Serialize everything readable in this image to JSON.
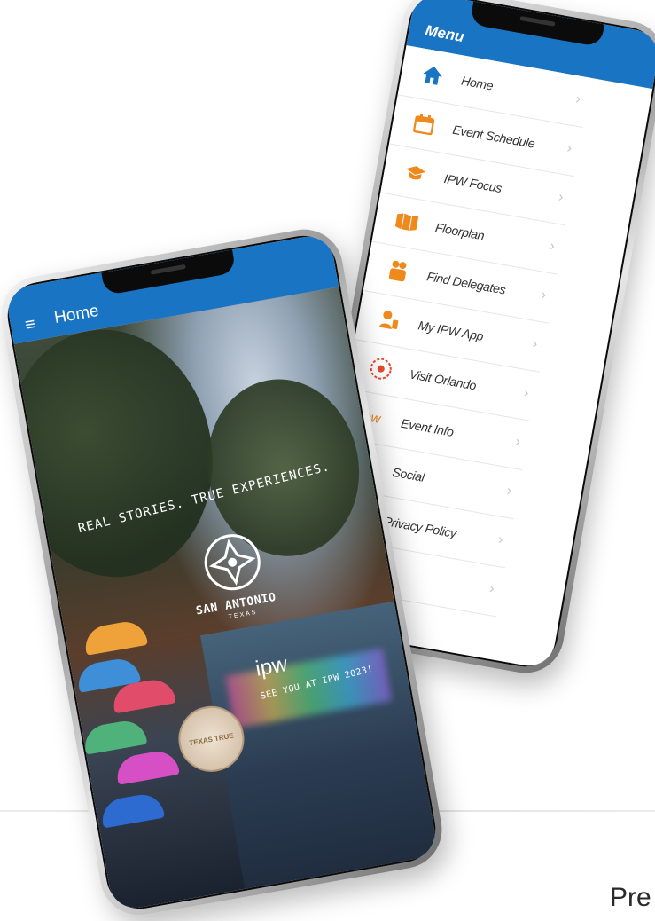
{
  "home_phone": {
    "appbar_title": "Home",
    "menu_icon": "hamburger-icon",
    "hero": {
      "tagline": "REAL STORIES. TRUE EXPERIENCES.",
      "city_logo_text": "SAN ANTONIO",
      "city_logo_sub": "TEXAS",
      "event_logo": "ipw",
      "see_you_text": "SEE YOU AT IPW 2023!",
      "badge_text": "TEXAS TRUE"
    }
  },
  "menu_phone": {
    "appbar_title": "Menu",
    "items": [
      {
        "label": "Home",
        "icon": "house-icon",
        "color": "#1a74c4"
      },
      {
        "label": "Event Schedule",
        "icon": "calendar-icon",
        "color": "#f0891c"
      },
      {
        "label": "IPW Focus",
        "icon": "graduation-cap-icon",
        "color": "#f0891c"
      },
      {
        "label": "Floorplan",
        "icon": "map-icon",
        "color": "#f0891c"
      },
      {
        "label": "Find Delegates",
        "icon": "people-icon",
        "color": "#f0891c"
      },
      {
        "label": "My IPW App",
        "icon": "person-icon",
        "color": "#f0891c"
      },
      {
        "label": "Visit Orlando",
        "icon": "orlando-logo-icon",
        "color": "#e8492d"
      },
      {
        "label": "Event Info",
        "icon": "ipw-logo-icon",
        "color": "#f0891c"
      },
      {
        "label": "Social",
        "icon": "social-icon",
        "color": "#f0891c"
      },
      {
        "label": "Privacy Policy",
        "icon": "shield-icon",
        "color": "#f0891c"
      },
      {
        "label": "",
        "icon": "",
        "color": "#f0891c"
      }
    ]
  },
  "footer_text": "Pre"
}
